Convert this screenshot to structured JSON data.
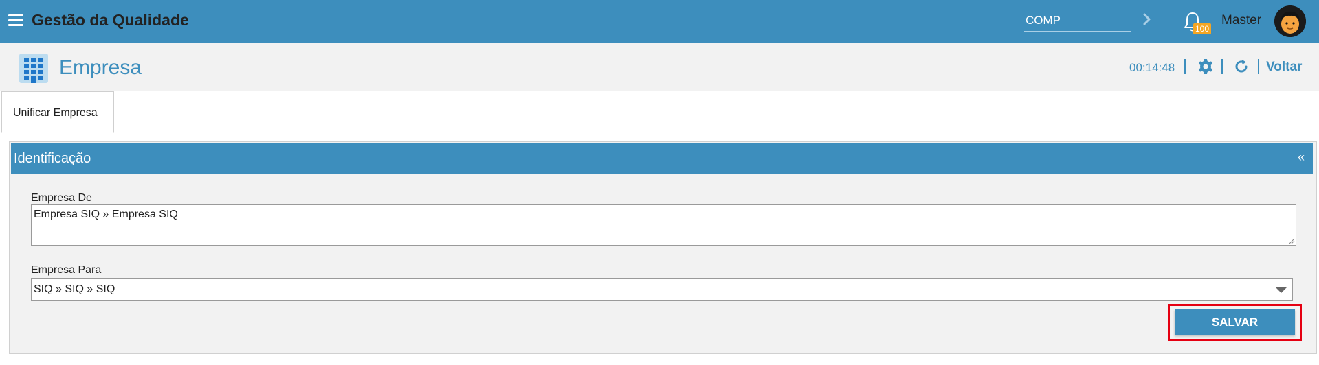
{
  "colors": {
    "primary": "#3d8ebd",
    "highlight": "#e50012",
    "badge": "#f5a623"
  },
  "topbar": {
    "menu_icon": "hamburger-menu-icon",
    "app_title": "Gestão da Qualidade",
    "company_input_value": "COMP",
    "notifications_count": "100",
    "user_name": "Master"
  },
  "page": {
    "title": "Empresa",
    "timer": "00:14:48",
    "back_label": "Voltar"
  },
  "tabs": [
    {
      "label": "Unificar Empresa",
      "active": true
    }
  ],
  "panel": {
    "title": "Identificação",
    "collapse_symbol": "«",
    "fields": {
      "empresa_de_label": "Empresa De",
      "empresa_de_value": "Empresa SIQ » Empresa SIQ",
      "empresa_para_label": "Empresa Para",
      "empresa_para_value": "SIQ » SIQ » SIQ"
    },
    "save_label": "SALVAR"
  }
}
